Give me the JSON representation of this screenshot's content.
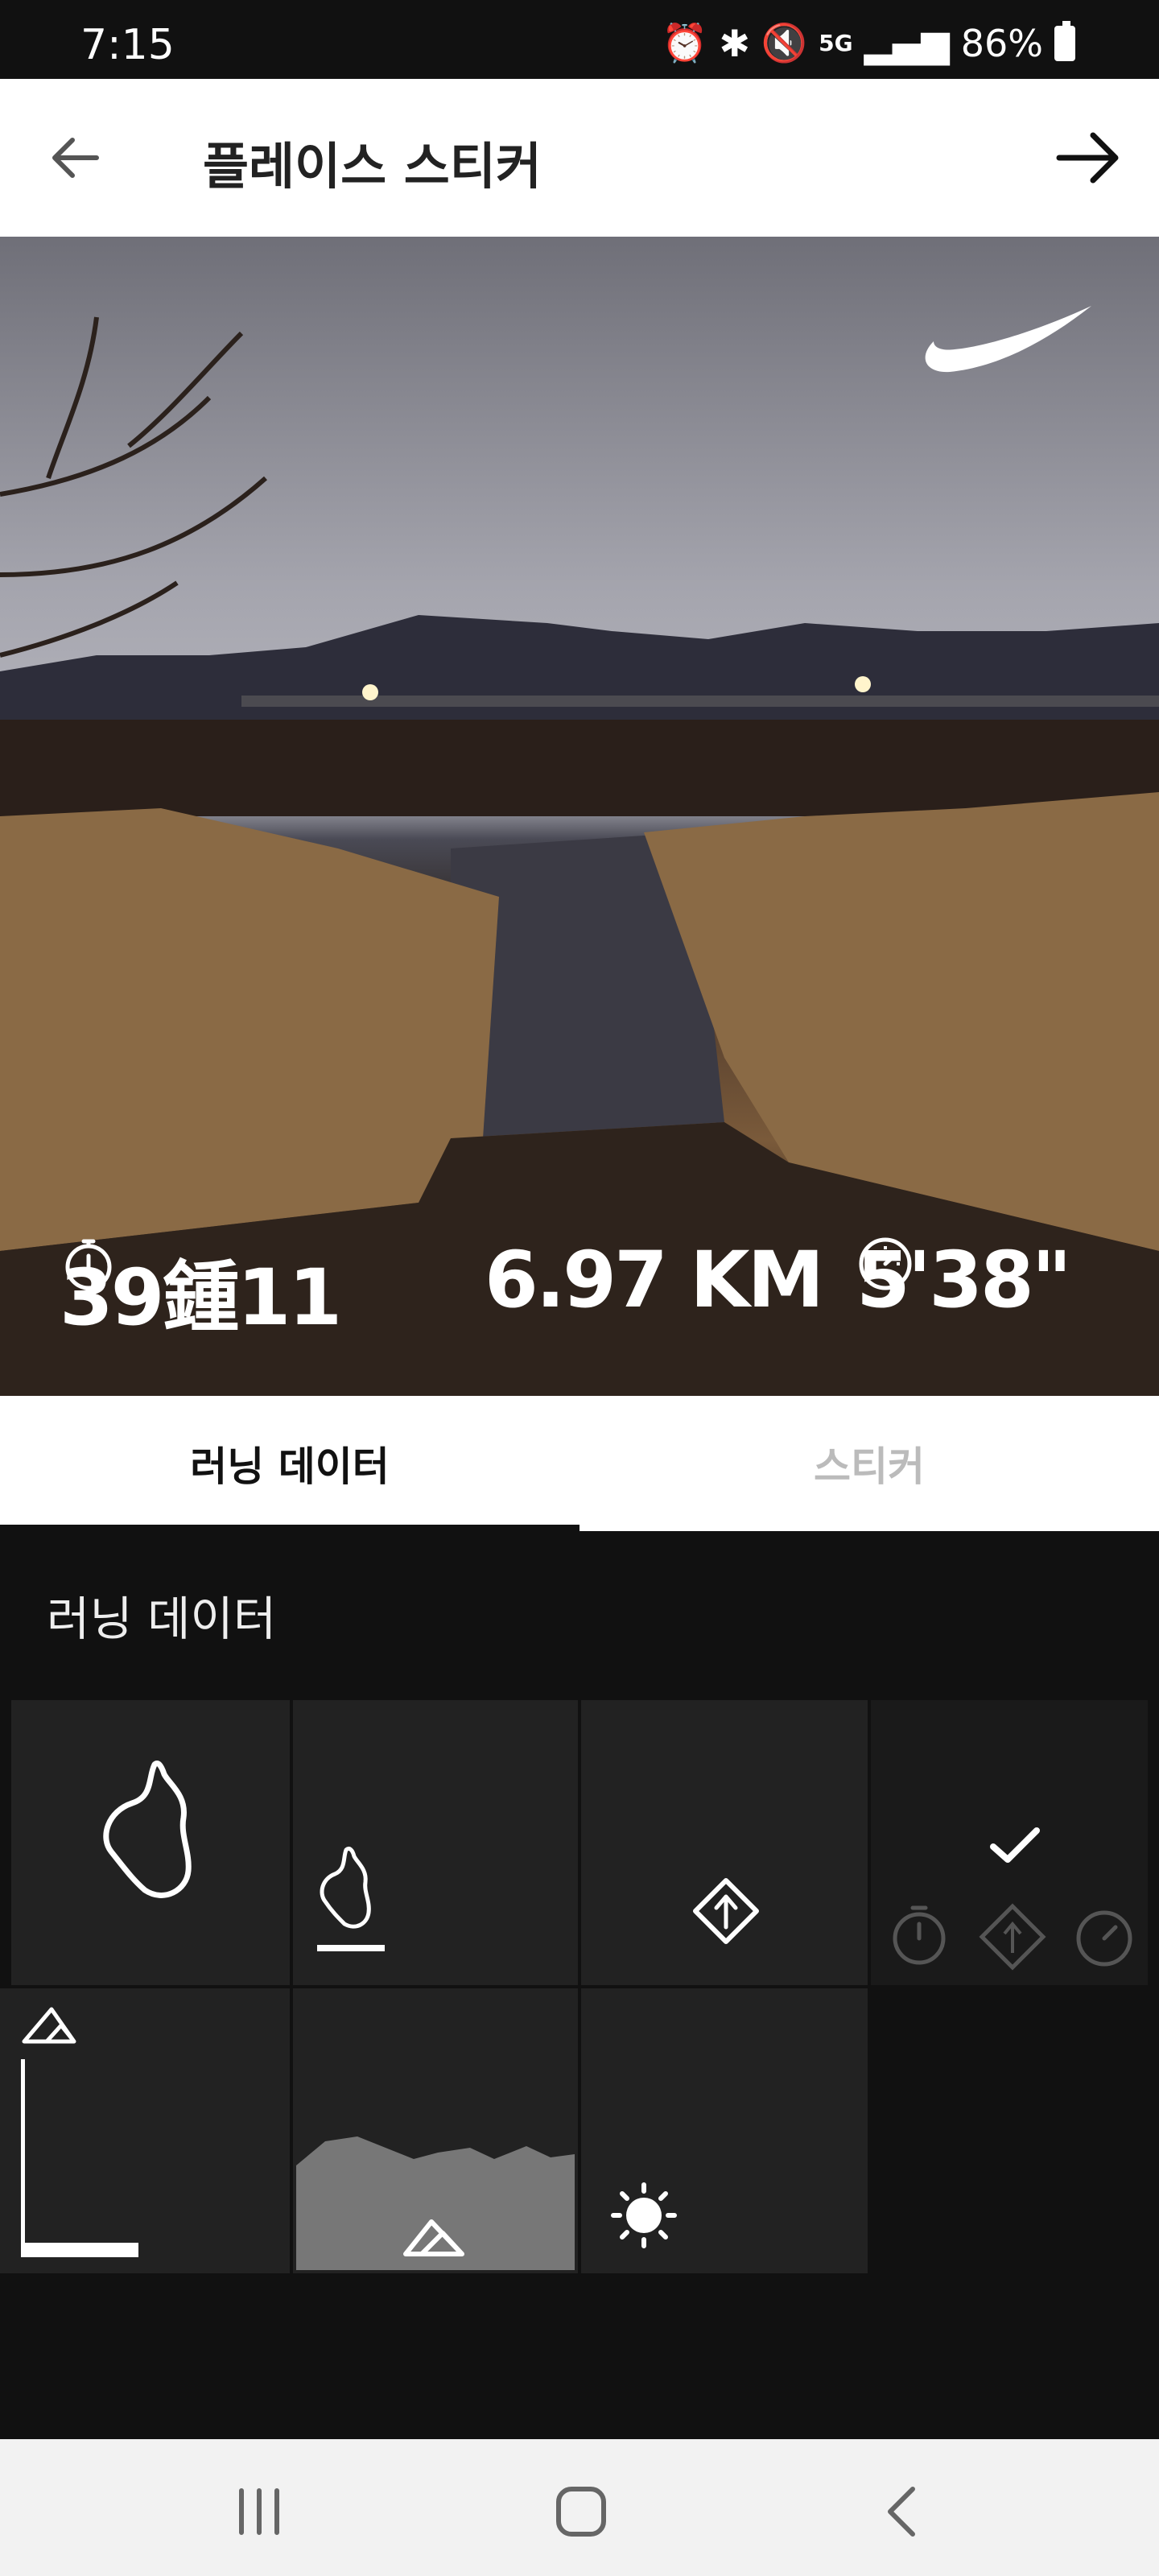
{
  "status_bar": {
    "time": "7:15",
    "icons": [
      "alarm-icon",
      "bluetooth-icon",
      "mute-icon",
      "5g-icon",
      "signal-icon"
    ],
    "battery": "86%"
  },
  "header": {
    "title": "플레이스 스티커"
  },
  "photo": {
    "brand_logo": "nike-swoosh",
    "stats": {
      "time": "39鍾11",
      "distance": "6.97 KM",
      "pace": "5'38\""
    }
  },
  "tabs": [
    {
      "label": "러닝 데이터",
      "active": true
    },
    {
      "label": "스티커",
      "active": false
    }
  ],
  "section": {
    "title": "러닝 데이터",
    "options": [
      {
        "name": "route-large",
        "icon": "route-icon"
      },
      {
        "name": "route-small-underline",
        "icon": "route-icon"
      },
      {
        "name": "direction-badge",
        "icon": "direction-icon"
      },
      {
        "name": "stats-row",
        "icon": "stats-icon",
        "selected": true
      },
      {
        "name": "elevation-bar",
        "icon": "mountain-icon"
      },
      {
        "name": "elevation-profile",
        "icon": "mountain-icon"
      },
      {
        "name": "weather",
        "icon": "sun-icon"
      }
    ]
  },
  "colors": {
    "header_bg": "#ffffff",
    "section_bg": "#111111",
    "cell_bg": "#222222",
    "tab_inactive": "#bbbbbb"
  }
}
